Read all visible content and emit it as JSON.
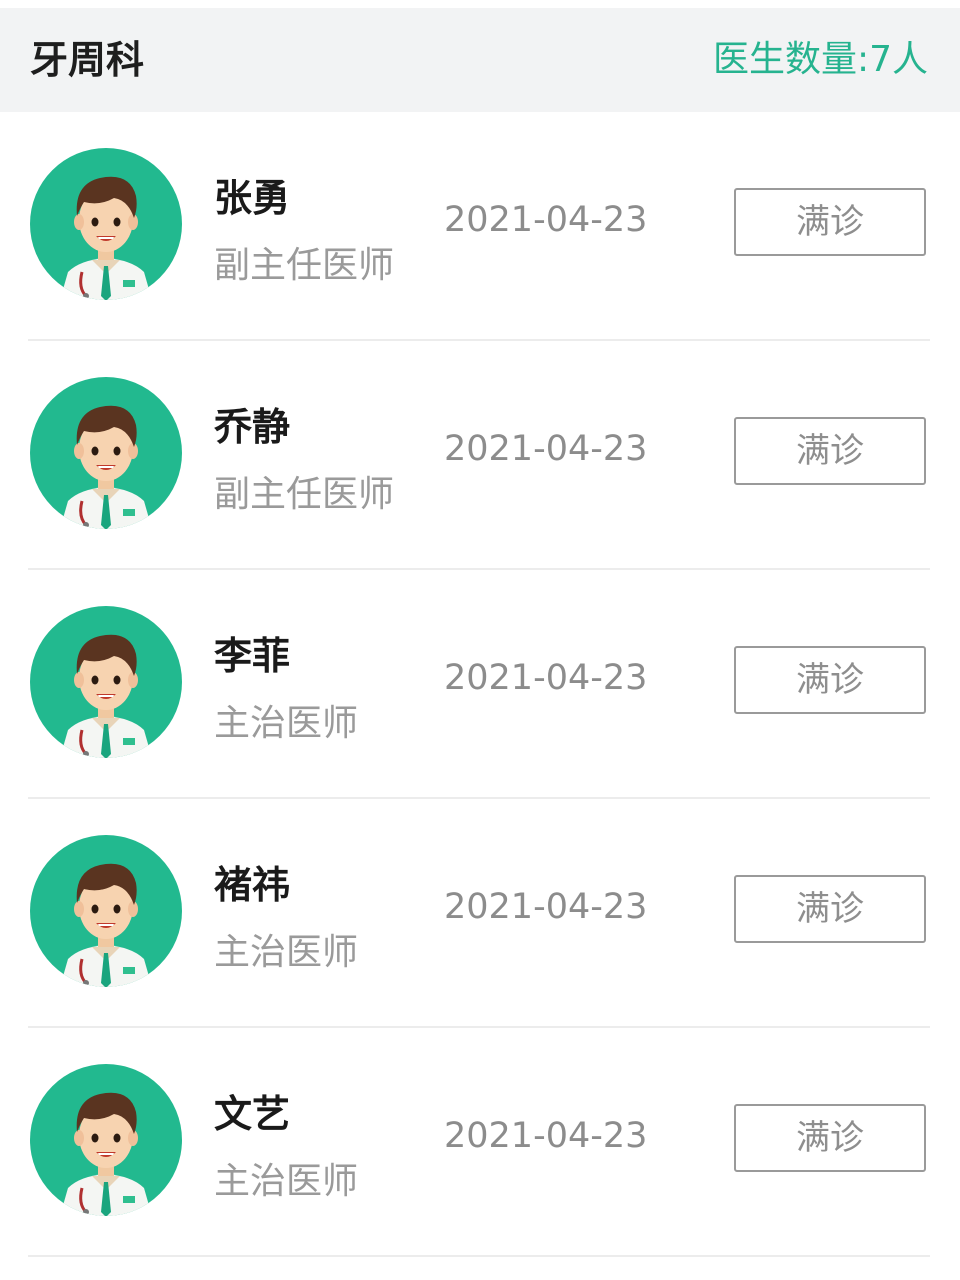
{
  "header": {
    "department": "牙周科",
    "doctor_count": "医生数量:7人"
  },
  "colors": {
    "accent": "#26b38f",
    "avatar_bg": "#22b98f"
  },
  "doctors": [
    {
      "name": "张勇",
      "title": "副主任医师",
      "date": "2021-04-23",
      "status": "满诊"
    },
    {
      "name": "乔静",
      "title": "副主任医师",
      "date": "2021-04-23",
      "status": "满诊"
    },
    {
      "name": "李菲",
      "title": "主治医师",
      "date": "2021-04-23",
      "status": "满诊"
    },
    {
      "name": "褚祎",
      "title": "主治医师",
      "date": "2021-04-23",
      "status": "满诊"
    },
    {
      "name": "文艺",
      "title": "主治医师",
      "date": "2021-04-23",
      "status": "满诊"
    }
  ]
}
